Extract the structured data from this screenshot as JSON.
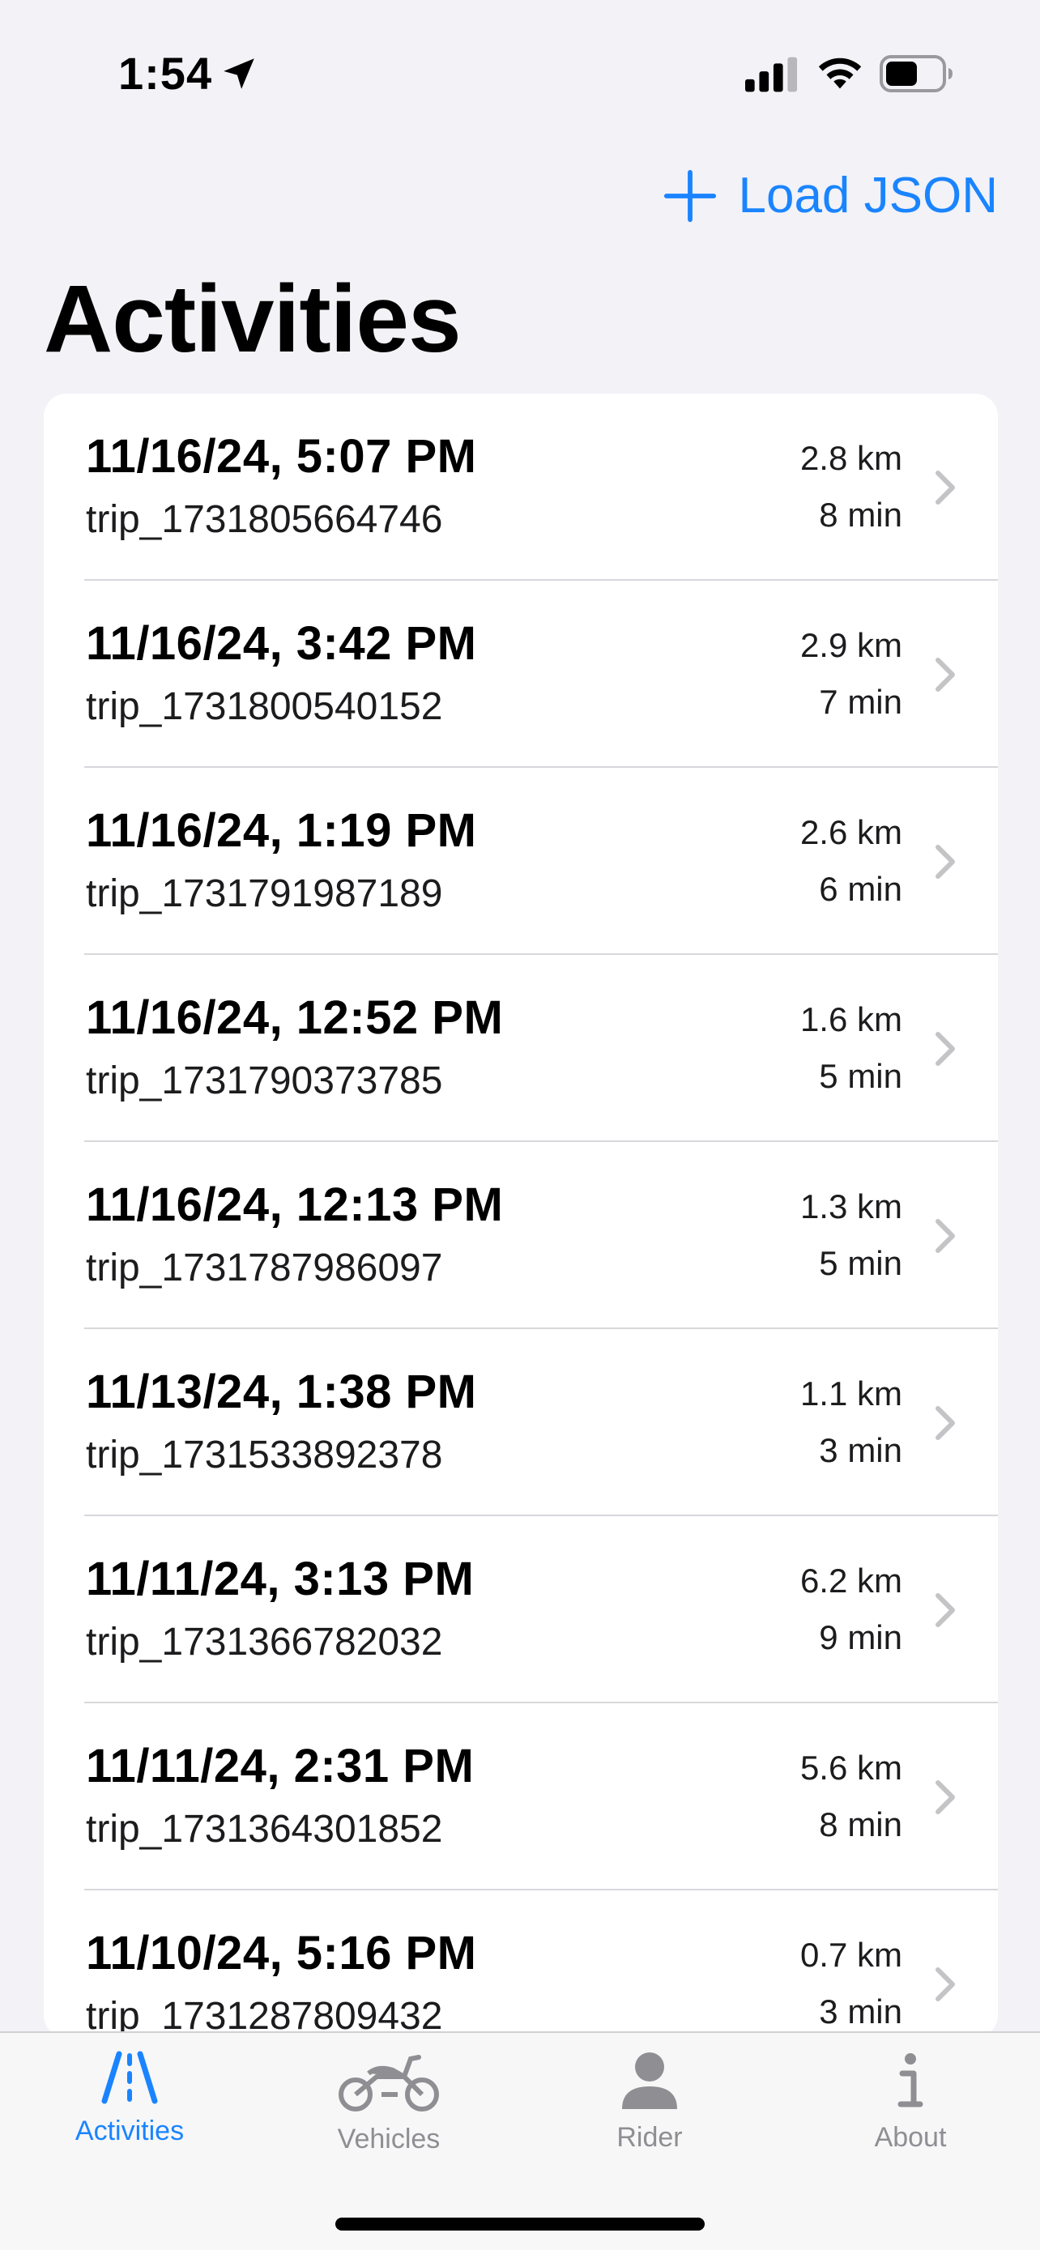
{
  "status_bar": {
    "time": "1:54"
  },
  "nav": {
    "load_label": "Load JSON",
    "title": "Activities"
  },
  "activities": [
    {
      "date": "11/16/24, 5:07 PM",
      "id": "trip_1731805664746",
      "distance": "2.8 km",
      "duration": "8 min"
    },
    {
      "date": "11/16/24, 3:42 PM",
      "id": "trip_1731800540152",
      "distance": "2.9 km",
      "duration": "7 min"
    },
    {
      "date": "11/16/24, 1:19 PM",
      "id": "trip_1731791987189",
      "distance": "2.6 km",
      "duration": "6 min"
    },
    {
      "date": "11/16/24, 12:52 PM",
      "id": "trip_1731790373785",
      "distance": "1.6 km",
      "duration": "5 min"
    },
    {
      "date": "11/16/24, 12:13 PM",
      "id": "trip_1731787986097",
      "distance": "1.3 km",
      "duration": "5 min"
    },
    {
      "date": "11/13/24, 1:38 PM",
      "id": "trip_1731533892378",
      "distance": "1.1 km",
      "duration": "3 min"
    },
    {
      "date": "11/11/24, 3:13 PM",
      "id": "trip_1731366782032",
      "distance": "6.2 km",
      "duration": "9 min"
    },
    {
      "date": "11/11/24, 2:31 PM",
      "id": "trip_1731364301852",
      "distance": "5.6 km",
      "duration": "8 min"
    },
    {
      "date": "11/10/24, 5:16 PM",
      "id": "trip_1731287809432",
      "distance": "0.7 km",
      "duration": "3 min"
    }
  ],
  "tabs": [
    {
      "label": "Activities",
      "icon": "activities-road-icon",
      "active": true
    },
    {
      "label": "Vehicles",
      "icon": "motorcycle-icon",
      "active": false
    },
    {
      "label": "Rider",
      "icon": "person-icon",
      "active": false
    },
    {
      "label": "About",
      "icon": "info-icon",
      "active": false
    }
  ],
  "colors": {
    "accent": "#1A84FF",
    "background": "#F2F2F7",
    "inactive_tab": "#8E8E93"
  }
}
